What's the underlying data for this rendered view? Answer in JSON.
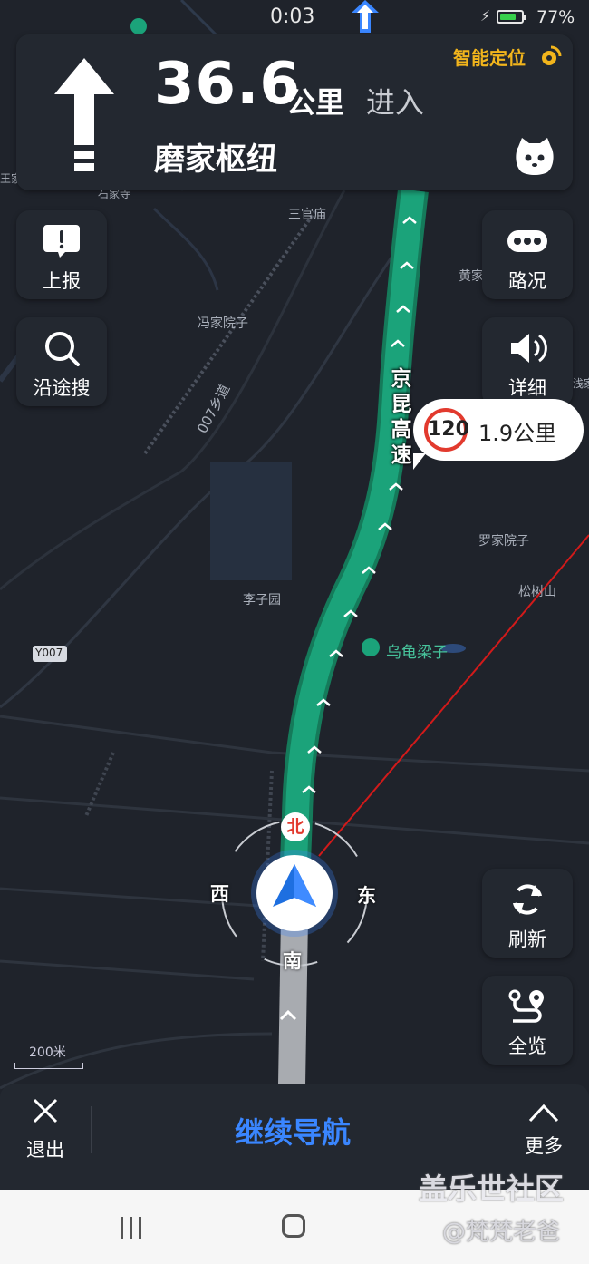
{
  "status": {
    "time": "0:03",
    "battery": "77%",
    "battery_level": 0.77
  },
  "nav": {
    "distance": "36.6",
    "unit": "公里",
    "action": "进入",
    "road": "磨家枢纽",
    "smart_location": "智能定位"
  },
  "left_buttons": [
    {
      "label": "上报",
      "icon": "report-icon"
    },
    {
      "label": "沿途搜",
      "icon": "search-icon"
    }
  ],
  "right_buttons": [
    {
      "label": "路况",
      "icon": "traffic-icon"
    },
    {
      "label": "详细",
      "icon": "speaker-icon"
    },
    {
      "label": "刷新",
      "icon": "refresh-icon"
    },
    {
      "label": "全览",
      "icon": "overview-icon"
    }
  ],
  "speed": {
    "limit": "120",
    "distance": "1.9公里"
  },
  "route_name": [
    "京",
    "昆",
    "高",
    "速"
  ],
  "map_labels": {
    "l1": "三官庙",
    "l2": "冯家院子",
    "l3": "黄家",
    "l4": "罗家院子",
    "l5": "松树山",
    "l6": "李子园",
    "l7": "乌龟梁子",
    "l8": "Y007",
    "l9": "石家寺",
    "l10": "王家",
    "l11": "浅家",
    "l12": "007乡道"
  },
  "compass": {
    "north": "北",
    "south": "南",
    "east": "东",
    "west": "西"
  },
  "scale": "200米",
  "bottom": {
    "exit": "退出",
    "continue": "继续导航",
    "more": "更多"
  },
  "watermark": {
    "site": "盖乐世社区",
    "user": "@梵梵老爸"
  },
  "colors": {
    "route": "#1ba37a",
    "route_passed": "#a8abb0",
    "accent": "#3a86ff",
    "speed_ring": "#e23a2e"
  }
}
